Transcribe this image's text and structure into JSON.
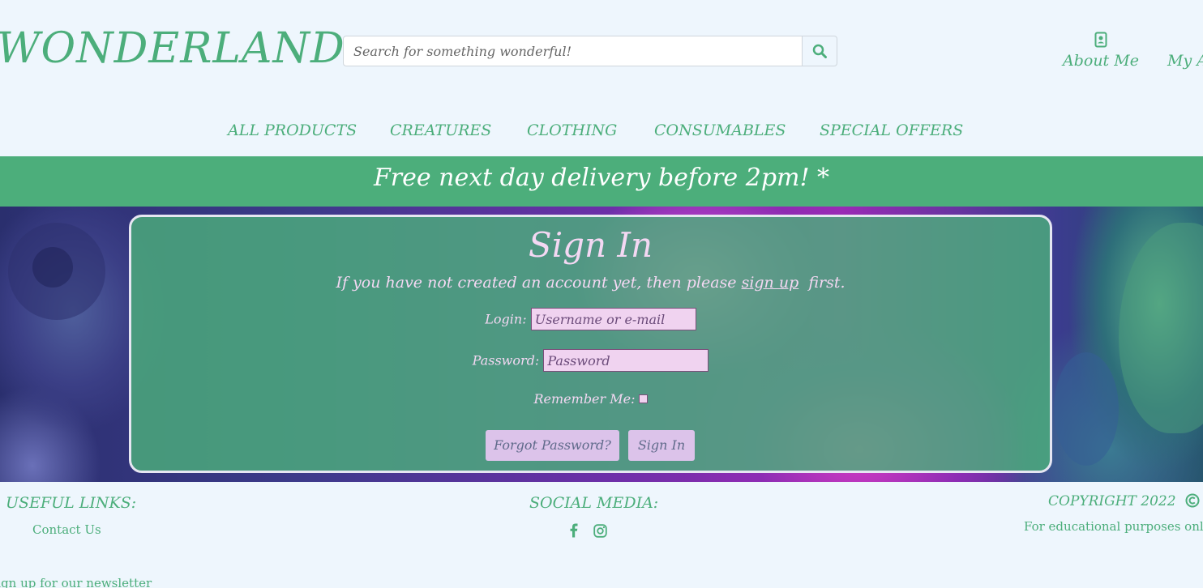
{
  "header": {
    "logo": "WONDERLAND",
    "search_placeholder": "Search for something wonderful!",
    "about_label": "About Me",
    "account_label": "My Account"
  },
  "nav": {
    "items": [
      "ALL PRODUCTS",
      "CREATURES",
      "CLOTHING",
      "CONSUMABLES",
      "SPECIAL OFFERS"
    ]
  },
  "banner": {
    "text": "Free next day delivery before 2pm! *"
  },
  "signin": {
    "title": "Sign In",
    "sub_prefix": "If you have not created an account yet, then please ",
    "sub_link": "sign up",
    "sub_suffix": "  first.",
    "login_label": "Login:",
    "login_placeholder": "Username or e-mail",
    "password_label": "Password:",
    "password_placeholder": "Password",
    "remember_label": "Remember Me:",
    "forgot_label": "Forgot Password?",
    "submit_label": "Sign In"
  },
  "footer": {
    "links_heading": "USEFUL LINKS:",
    "contact": "Contact Us",
    "newsletter": "Sign up for our newsletter",
    "social_heading": "SOCIAL MEDIA:",
    "copyright_heading": "COPYRIGHT 2022",
    "copyright_note": "For educational purposes only"
  },
  "colors": {
    "accent": "#4cae7b",
    "background": "#eef6fd",
    "card_text": "#f4d8f3"
  },
  "icons": [
    "search-icon",
    "contact-card-icon",
    "user-icon",
    "copyright-icon",
    "facebook-icon",
    "instagram-icon"
  ]
}
